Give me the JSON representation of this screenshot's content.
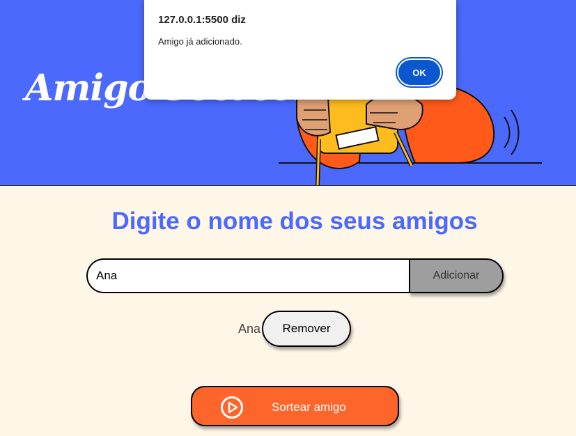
{
  "header": {
    "title": "Amigo Secreto"
  },
  "main": {
    "heading": "Digite o nome dos seus amigos",
    "input": {
      "value": "Ana",
      "placeholder": ""
    },
    "add_button_label": "Adicionar",
    "friends": [
      {
        "name": "Ana",
        "remove_label": "Remover"
      }
    ],
    "draw_button_label": "Sortear amigo",
    "draw_icon": "play-circle-icon"
  },
  "alert": {
    "origin": "127.0.0.1:5500 diz",
    "message": "Amigo já adicionado.",
    "ok_label": "OK"
  },
  "colors": {
    "header_bg": "#4b69fd",
    "page_bg": "#fef6e7",
    "heading": "#4b69fd",
    "add_button": "#9e9e9e",
    "draw_button": "#fe652b",
    "ok_button": "#0b57d0"
  }
}
